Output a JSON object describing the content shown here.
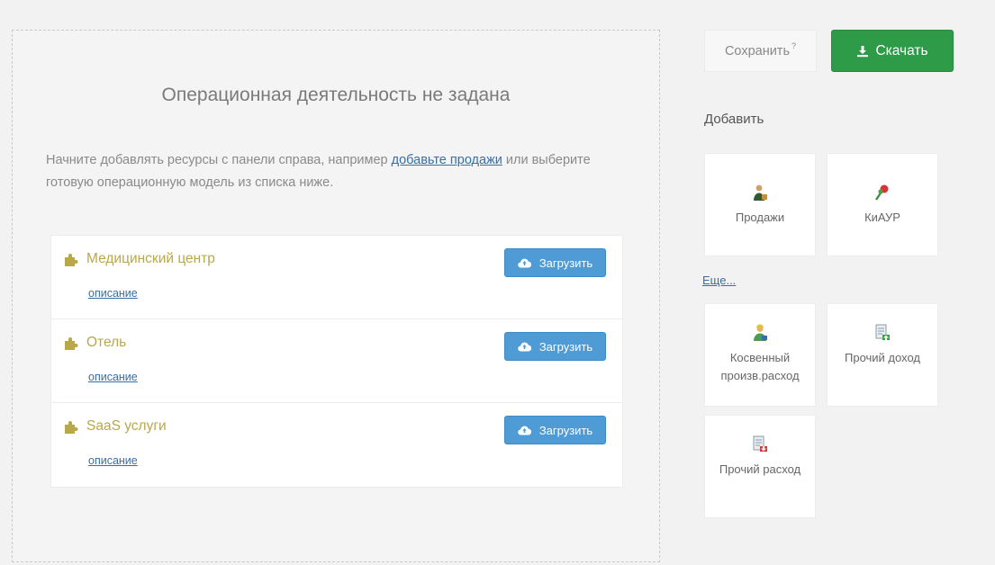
{
  "main": {
    "empty_title": "Операционная деятельность не задана",
    "hint_before": "Начните добавлять ресурсы с панели справа, например ",
    "hint_link": "добавьте продажи",
    "hint_after": " или выберите готовую операционную модель из списка ниже.",
    "models": [
      {
        "title": "Медицинский центр",
        "description": "описание",
        "button": "Загрузить"
      },
      {
        "title": "Отель",
        "description": "описание",
        "button": "Загрузить"
      },
      {
        "title": "SaaS услуги",
        "description": "описание",
        "button": "Загрузить"
      }
    ]
  },
  "toolbar": {
    "save_label": "Сохранить",
    "save_hint_icon": "?",
    "download_label": "Скачать"
  },
  "sidebar": {
    "add_label": "Добавить",
    "more_link": "Еще...",
    "tiles": [
      {
        "label": "Продажи",
        "icon": "sales-person-icon"
      },
      {
        "label": "КиАУР",
        "icon": "pushpin-icon"
      },
      {
        "label": "Косвенный произв.расход",
        "icon": "worker-icon"
      },
      {
        "label": "Прочий доход",
        "icon": "income-doc-icon"
      },
      {
        "label": "Прочий расход",
        "icon": "expense-doc-icon"
      }
    ]
  },
  "colors": {
    "accent_green": "#2e9b48",
    "button_blue": "#4f9bd6",
    "model_title": "#b9a84a",
    "link": "#3a6ea5"
  }
}
